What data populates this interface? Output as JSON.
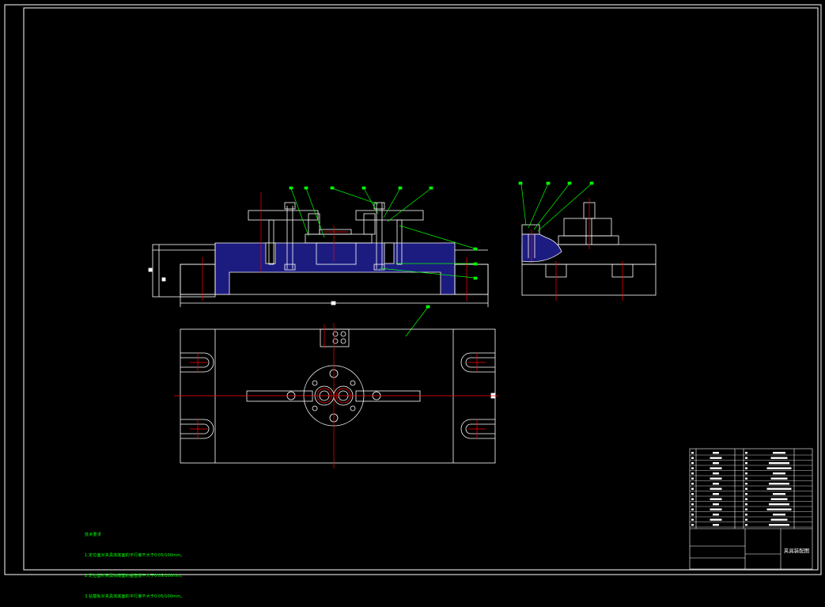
{
  "drawing": {
    "technical_requirements": {
      "heading": "技术要求",
      "items": [
        "1.定位面对夹具体底面的平行度不大于0.05/100mm。",
        "2.定位面对夹具体底面的垂直度不大于0.05/100mm。",
        "3.钻模板对夹具体底面的平行度不大于0.05/100mm。"
      ]
    },
    "title_block": {
      "drawing_name": "夹具装配图"
    }
  },
  "colors": {
    "background": "#000000",
    "outline": "#ffffff",
    "centerline": "#ff0000",
    "leader": "#00ff00",
    "hatch": "#1c1c80",
    "text": "#00ff00"
  }
}
